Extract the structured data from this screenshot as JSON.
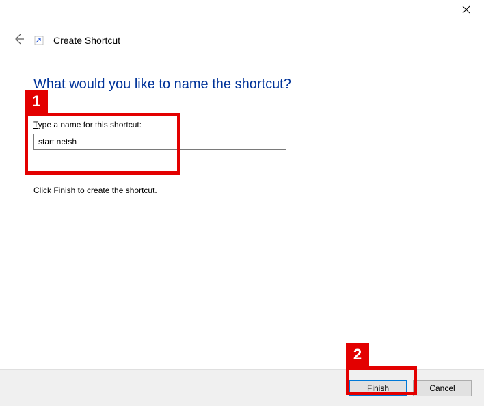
{
  "window": {
    "title": "Create Shortcut"
  },
  "heading": "What would you like to name the shortcut?",
  "field": {
    "label_prefix_underlined": "T",
    "label_rest": "ype a name for this shortcut:",
    "value": "start netsh"
  },
  "hint": "Click Finish to create the shortcut.",
  "buttons": {
    "finish_underlined": "F",
    "finish_rest": "inish",
    "cancel": "Cancel"
  },
  "annotations": {
    "one": "1",
    "two": "2"
  }
}
